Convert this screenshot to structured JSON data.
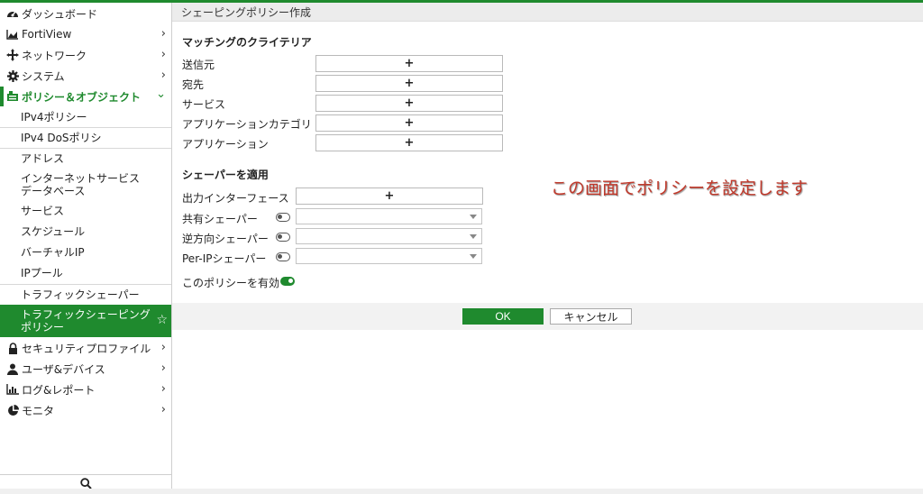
{
  "sidebar": {
    "items": [
      {
        "label": "ダッシュボード",
        "icon": "dashboard-icon"
      },
      {
        "label": "FortiView",
        "icon": "chart-icon"
      },
      {
        "label": "ネットワーク",
        "icon": "network-icon"
      },
      {
        "label": "システム",
        "icon": "gear-icon"
      },
      {
        "label": "ポリシー＆オブジェクト",
        "icon": "policy-icon"
      },
      {
        "label": "セキュリティプロファイル",
        "icon": "lock-icon"
      },
      {
        "label": "ユーザ&デバイス",
        "icon": "user-icon"
      },
      {
        "label": "ログ&レポート",
        "icon": "bar-chart-icon"
      },
      {
        "label": "モニタ",
        "icon": "pie-chart-icon"
      }
    ],
    "sub_items": [
      {
        "label": "IPv4ポリシー"
      },
      {
        "label": "IPv4 DoSポリシ"
      },
      {
        "label": "アドレス"
      },
      {
        "label": "インターネットサービス"
      },
      {
        "label": "データベース"
      },
      {
        "label": "サービス"
      },
      {
        "label": "スケジュール"
      },
      {
        "label": "バーチャルIP"
      },
      {
        "label": "IPプール"
      },
      {
        "label": "トラフィックシェーパー"
      },
      {
        "label": "トラフィックシェーピング"
      },
      {
        "label": "ポリシー"
      }
    ]
  },
  "page": {
    "title": "シェーピングポリシー作成",
    "matching_title": "マッチングのクライテリア",
    "matching_rows": [
      {
        "label": "送信元",
        "plus": "+"
      },
      {
        "label": "宛先",
        "plus": "+"
      },
      {
        "label": "サービス",
        "plus": "+"
      },
      {
        "label": "アプリケーションカテゴリ",
        "plus": "+"
      },
      {
        "label": "アプリケーション",
        "plus": "+"
      }
    ],
    "shaper_title": "シェーパーを適用",
    "out_interface_label": "出力インターフェース",
    "out_interface_plus": "+",
    "shared_shaper_label": "共有シェーパー",
    "reverse_shaper_label": "逆方向シェーパー",
    "per_ip_shaper_label": "Per-IPシェーパー",
    "enable_policy_label": "このポリシーを有効",
    "annotation": "この画面でポリシーを設定します",
    "ok_label": "OK",
    "cancel_label": "キャンセル"
  },
  "colors": {
    "accent": "#1f8a2e",
    "annotation": "#c0392b"
  }
}
